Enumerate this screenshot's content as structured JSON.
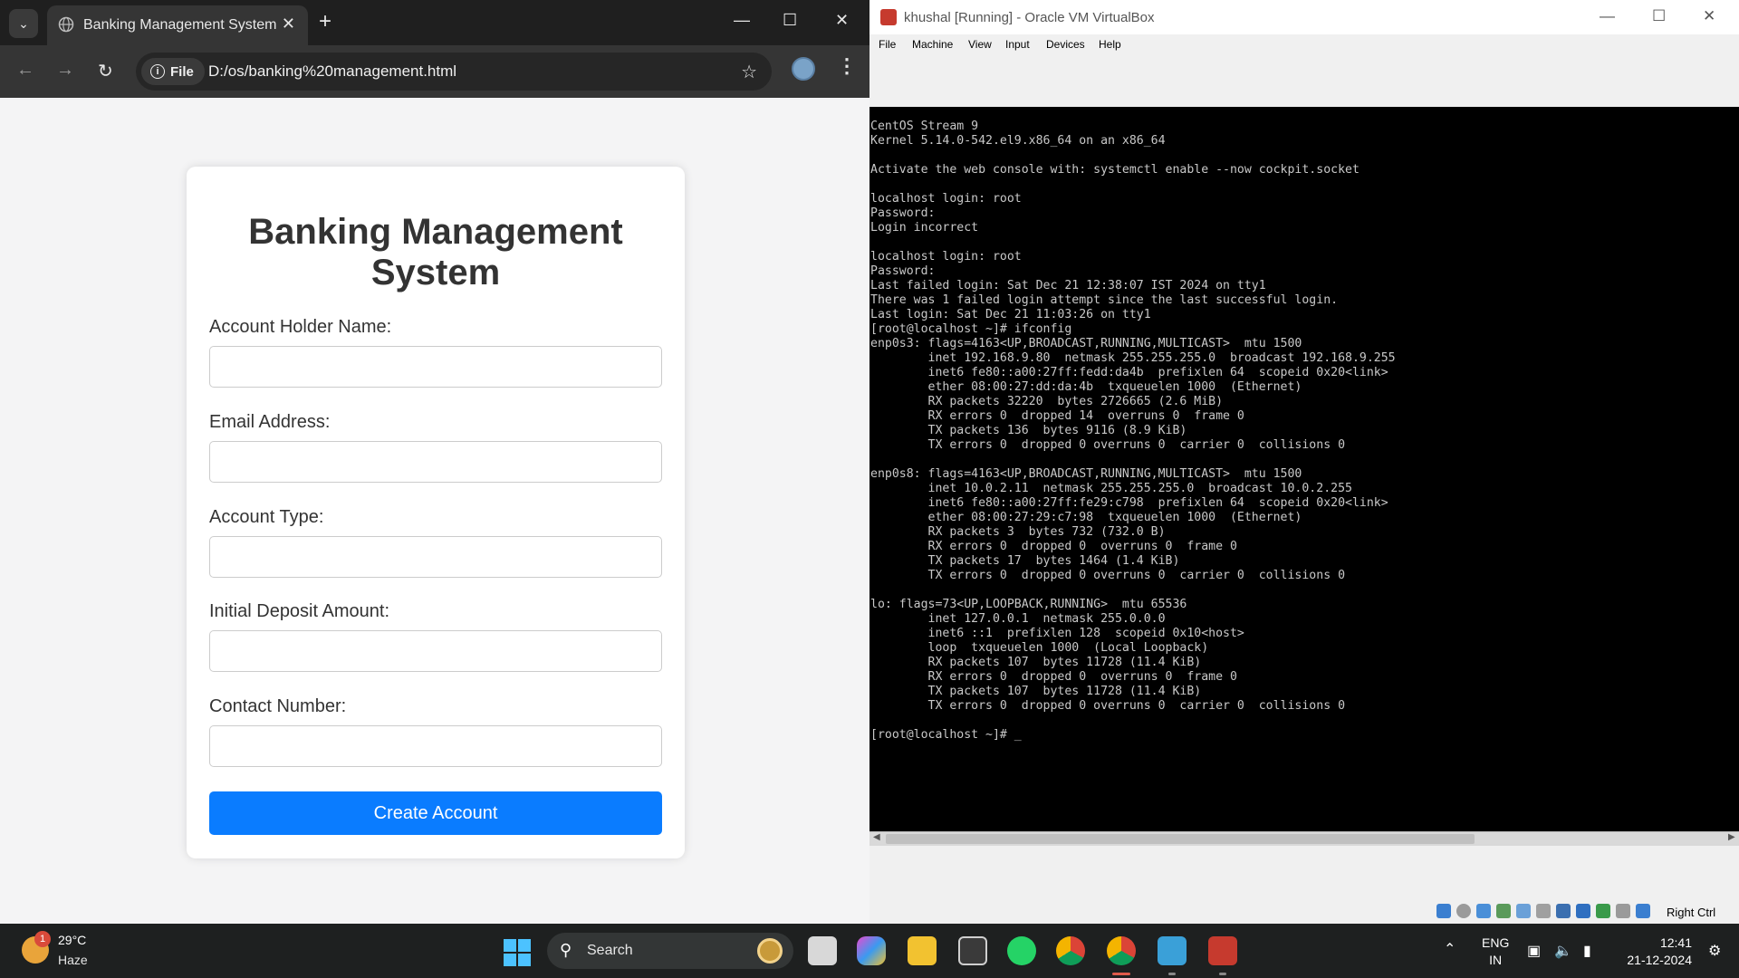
{
  "chrome": {
    "tab_title": "Banking Management System",
    "site_chip": "File",
    "url": "D:/os/banking%20management.html",
    "page": {
      "heading": "Banking Management System",
      "fields": [
        {
          "label": "Account Holder Name:",
          "value": ""
        },
        {
          "label": "Email Address:",
          "value": ""
        },
        {
          "label": "Account Type:",
          "value": ""
        },
        {
          "label": "Initial Deposit Amount:",
          "value": ""
        },
        {
          "label": "Contact Number:",
          "value": ""
        }
      ],
      "submit_label": "Create Account",
      "accent_color": "#0a7cff"
    }
  },
  "vbox": {
    "title": "khushal [Running] - Oracle VM VirtualBox",
    "menu": [
      "File",
      "Machine",
      "View",
      "Input",
      "Devices",
      "Help"
    ],
    "console_lines": [
      "CentOS Stream 9",
      "Kernel 5.14.0-542.el9.x86_64 on an x86_64",
      "",
      "Activate the web console with: systemctl enable --now cockpit.socket",
      "",
      "localhost login: root",
      "Password:",
      "Login incorrect",
      "",
      "localhost login: root",
      "Password:",
      "Last failed login: Sat Dec 21 12:38:07 IST 2024 on tty1",
      "There was 1 failed login attempt since the last successful login.",
      "Last login: Sat Dec 21 11:03:26 on tty1",
      "[root@localhost ~]# ifconfig",
      "enp0s3: flags=4163<UP,BROADCAST,RUNNING,MULTICAST>  mtu 1500",
      "        inet 192.168.9.80  netmask 255.255.255.0  broadcast 192.168.9.255",
      "        inet6 fe80::a00:27ff:fedd:da4b  prefixlen 64  scopeid 0x20<link>",
      "        ether 08:00:27:dd:da:4b  txqueuelen 1000  (Ethernet)",
      "        RX packets 32220  bytes 2726665 (2.6 MiB)",
      "        RX errors 0  dropped 14  overruns 0  frame 0",
      "        TX packets 136  bytes 9116 (8.9 KiB)",
      "        TX errors 0  dropped 0 overruns 0  carrier 0  collisions 0",
      "",
      "enp0s8: flags=4163<UP,BROADCAST,RUNNING,MULTICAST>  mtu 1500",
      "        inet 10.0.2.11  netmask 255.255.255.0  broadcast 10.0.2.255",
      "        inet6 fe80::a00:27ff:fe29:c798  prefixlen 64  scopeid 0x20<link>",
      "        ether 08:00:27:29:c7:98  txqueuelen 1000  (Ethernet)",
      "        RX packets 3  bytes 732 (732.0 B)",
      "        RX errors 0  dropped 0  overruns 0  frame 0",
      "        TX packets 17  bytes 1464 (1.4 KiB)",
      "        TX errors 0  dropped 0 overruns 0  carrier 0  collisions 0",
      "",
      "lo: flags=73<UP,LOOPBACK,RUNNING>  mtu 65536",
      "        inet 127.0.0.1  netmask 255.0.0.0",
      "        inet6 ::1  prefixlen 128  scopeid 0x10<host>",
      "        loop  txqueuelen 1000  (Local Loopback)",
      "        RX packets 107  bytes 11728 (11.4 KiB)",
      "        RX errors 0  dropped 0  overruns 0  frame 0",
      "        TX packets 107  bytes 11728 (11.4 KiB)",
      "        TX errors 0  dropped 0 overruns 0  carrier 0  collisions 0",
      "",
      "[root@localhost ~]# _"
    ],
    "host_key": "Right Ctrl"
  },
  "taskbar": {
    "weather_temp": "29°C",
    "weather_desc": "Haze",
    "weather_badge": "1",
    "search_label": "Search",
    "lang_line1": "ENG",
    "lang_line2": "IN",
    "time": "12:41",
    "date": "21-12-2024"
  }
}
